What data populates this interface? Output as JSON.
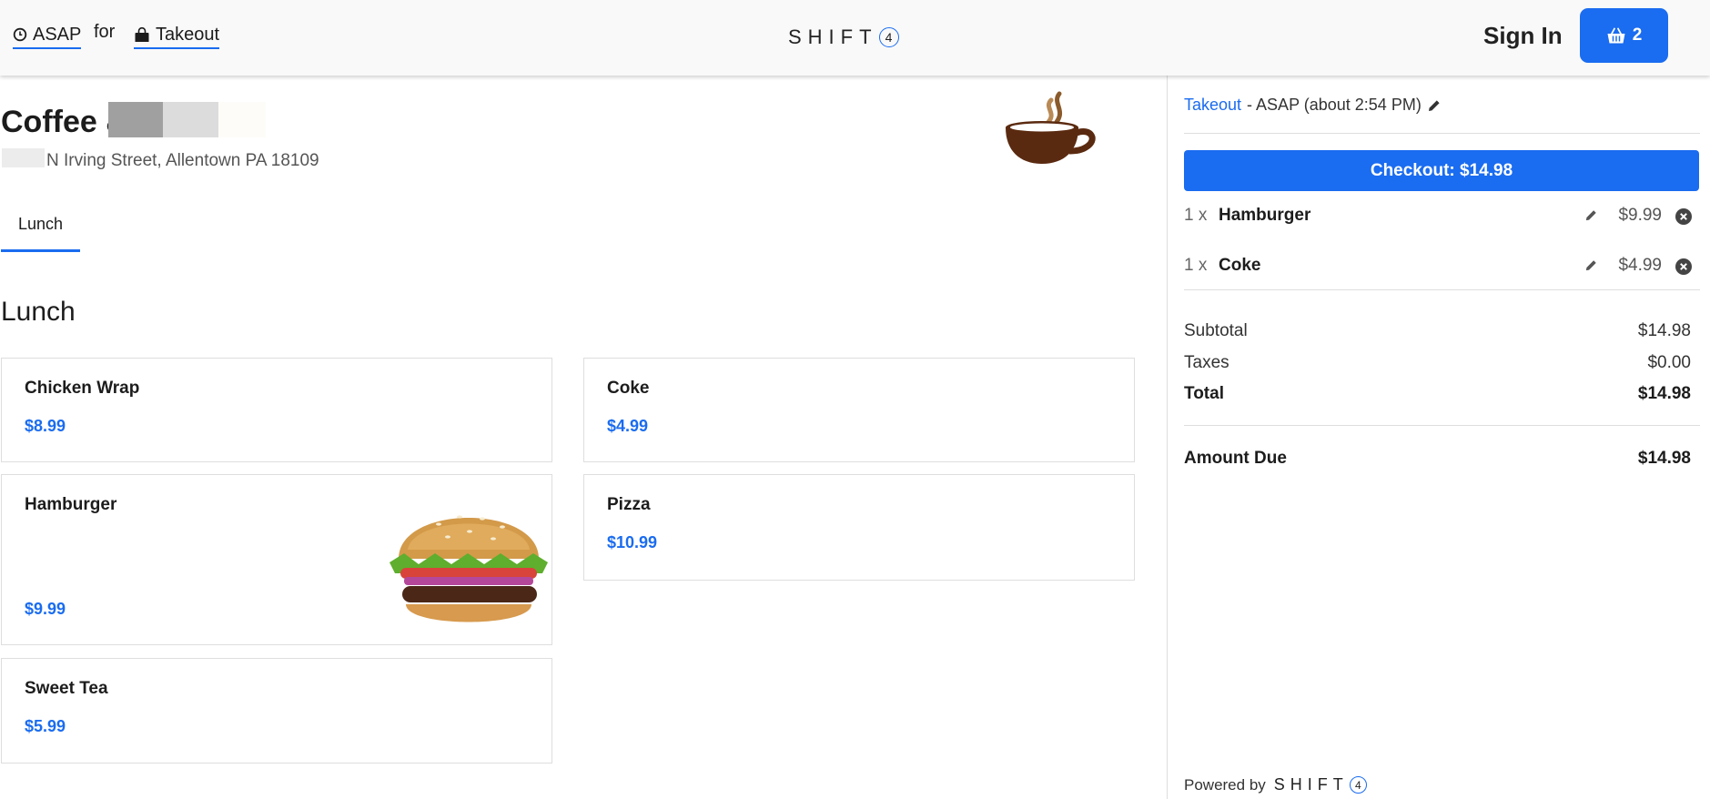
{
  "header": {
    "time_option": "ASAP",
    "connector": "for",
    "mode_option": "Takeout",
    "logo_text": "SHIFT",
    "logo_digit": "4",
    "sign_in": "Sign In",
    "cart_count": "2",
    "accent": "#1a6cf0"
  },
  "store": {
    "name_visible": "Coffee &",
    "address": "N Irving Street, Allentown PA 18109"
  },
  "menu": {
    "tabs": [
      {
        "label": "Lunch"
      }
    ],
    "section_title": "Lunch",
    "items": [
      {
        "name": "Chicken Wrap",
        "price": "$8.99"
      },
      {
        "name": "Coke",
        "price": "$4.99"
      },
      {
        "name": "Hamburger",
        "price": "$9.99"
      },
      {
        "name": "Pizza",
        "price": "$10.99"
      },
      {
        "name": "Sweet Tea",
        "price": "$5.99"
      }
    ]
  },
  "order": {
    "mode_link": "Takeout",
    "time_text": "- ASAP (about 2:54 PM)",
    "checkout_label": "Checkout: $14.98",
    "lines": [
      {
        "qty": "1 x",
        "name": "Hamburger",
        "price": "$9.99"
      },
      {
        "qty": "1 x",
        "name": "Coke",
        "price": "$4.99"
      }
    ],
    "subtotal_label": "Subtotal",
    "subtotal": "$14.98",
    "taxes_label": "Taxes",
    "taxes": "$0.00",
    "total_label": "Total",
    "total": "$14.98",
    "amount_due_label": "Amount Due",
    "amount_due": "$14.98",
    "powered_by": "Powered by"
  }
}
